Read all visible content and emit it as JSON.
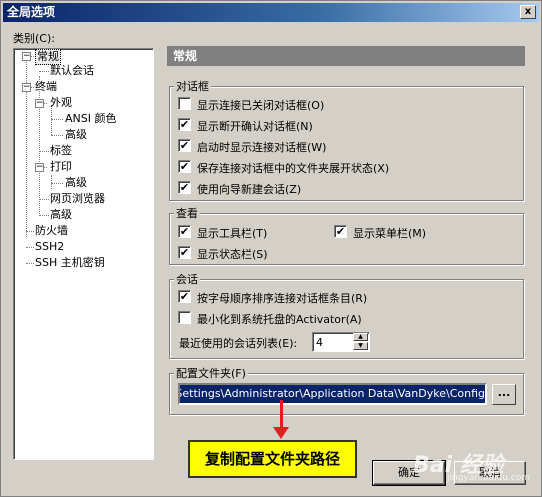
{
  "window": {
    "title": "全局选项",
    "close_glyph": "x"
  },
  "category_label": "类别(C):",
  "tree": [
    {
      "label": "常规",
      "selected": true
    },
    {
      "label": "默认会话"
    },
    {
      "label": "终端"
    },
    {
      "label": "外观"
    },
    {
      "label": "ANSI 颜色"
    },
    {
      "label": "高级"
    },
    {
      "label": "标签"
    },
    {
      "label": "打印"
    },
    {
      "label": "高级"
    },
    {
      "label": "网页浏览器"
    },
    {
      "label": "高级"
    },
    {
      "label": "防火墙"
    },
    {
      "label": "SSH2"
    },
    {
      "label": "SSH 主机密钥"
    }
  ],
  "tree_toggles": {
    "collapse": "−"
  },
  "header": {
    "title": "常规"
  },
  "dialog_group": {
    "title": "对话框",
    "items": [
      {
        "label": "显示连接已关闭对话框(O)",
        "checked": false
      },
      {
        "label": "显示断开确认对话框(N)",
        "checked": true
      },
      {
        "label": "启动时显示连接对话框(W)",
        "checked": true
      },
      {
        "label": "保存连接对话框中的文件夹展开状态(X)",
        "checked": true
      },
      {
        "label": "使用向导新建会话(Z)",
        "checked": true
      }
    ]
  },
  "view_group": {
    "title": "查看",
    "items": [
      {
        "label": "显示工具栏(T)",
        "checked": true
      },
      {
        "label": "显示菜单栏(M)",
        "checked": true
      },
      {
        "label": "显示状态栏(S)",
        "checked": true
      }
    ]
  },
  "session_group": {
    "title": "会话",
    "items": [
      {
        "label": "按字母顺序排序连接对话框条目(R)",
        "checked": true
      },
      {
        "label": "最小化到系统托盘的Activator(A)",
        "checked": false
      }
    ],
    "recent_label": "最近使用的会话列表(E):",
    "recent_value": "4"
  },
  "config_group": {
    "title": "配置文件夹(F)",
    "path": "s and Settings\\Administrator\\Application Data\\VanDyke\\Config",
    "browse_label": "..."
  },
  "check_glyph": "✔",
  "spin_glyphs": {
    "up": "▲",
    "down": "▼"
  },
  "callout": "复制配置文件夹路径",
  "buttons": {
    "ok": "确定",
    "cancel": "取消"
  },
  "watermark": {
    "main": "Bai 经验",
    "sub": "jingyan.baidu.com"
  },
  "colors": {
    "title_bar": "#0a246a",
    "callout_bg": "#ffff00",
    "arrow": "#e02020",
    "selection": "#0a246a"
  }
}
